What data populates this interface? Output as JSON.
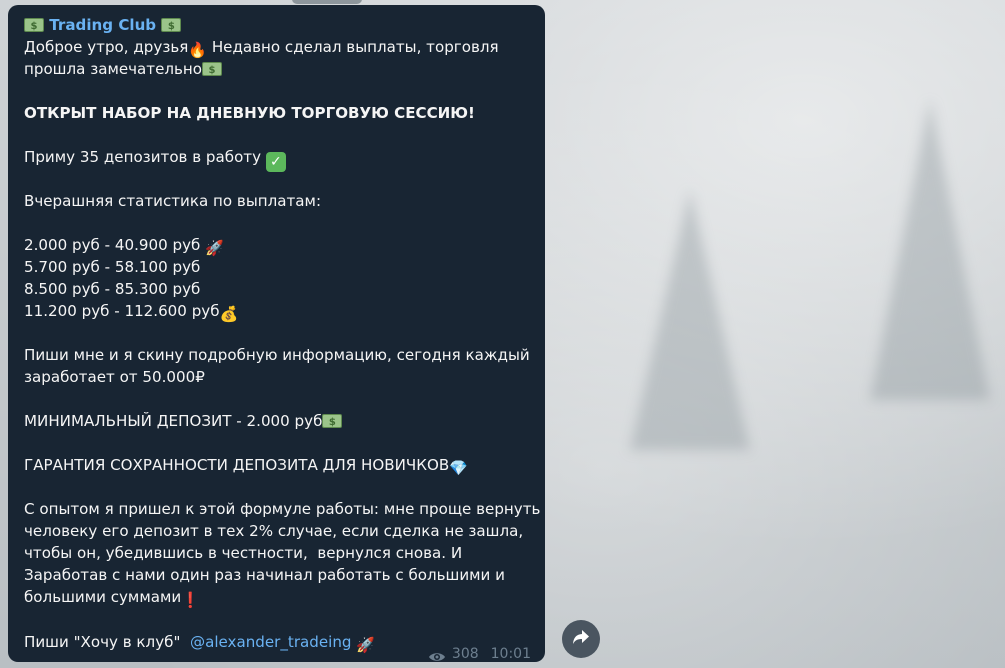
{
  "message": {
    "channel_name": "Trading Club",
    "line1": "Доброе утро, друзья",
    "line1b": " Недавно сделал выплаты, торговля",
    "line2": "прошла замечательно",
    "headline": "ОТКРЫТ НАБОР НА ДНЕВНУЮ ТОРГОВУЮ СЕССИЮ!",
    "deposits": "Приму 35 депозитов в работу ",
    "stats_title": "Вчерашняя статистика по выплатам:",
    "stats": [
      "2.000 руб - 40.900 руб ",
      "5.700 руб - 58.100 руб",
      "8.500 руб - 85.300 руб",
      "11.200 руб - 112.600 руб"
    ],
    "info1": "Пиши мне и я скину подробную информацию, сегодня каждый",
    "info2": "заработает от 50.000₽",
    "min_deposit": "МИНИМАЛЬНЫЙ ДЕПОЗИТ - 2.000 руб",
    "guarantee": "ГАРАНТИЯ СОХРАННОСТИ ДЕПОЗИТА ДЛЯ НОВИЧКОВ",
    "para": [
      "С опытом я пришел к этой формуле работы: мне проще вернуть",
      "человеку его депозит в тех 2% случае, если сделка не зашла,",
      "чтобы он, убедившись в честности,  вернулся снова. И",
      "Заработав с нами один раз начинал работать с большими и",
      "большими суммами"
    ],
    "cta_text": "Пиши \"Хочу в клуб\"  ",
    "cta_link": "@alexander_tradeing",
    "views": "308",
    "time": "10:01"
  },
  "icons": {
    "money": "banknote-icon",
    "fire": "fire-icon",
    "check": "check-mark-icon",
    "rocket": "rocket-icon",
    "moneybag": "money-bag-icon",
    "diamond": "diamond-icon",
    "exclamation": "red-exclamation-icon",
    "eye": "eye-icon",
    "share": "share-arrow-icon"
  },
  "colors": {
    "bubble": "#182533",
    "link": "#6ab2f2",
    "meta": "#6d7f8f"
  }
}
